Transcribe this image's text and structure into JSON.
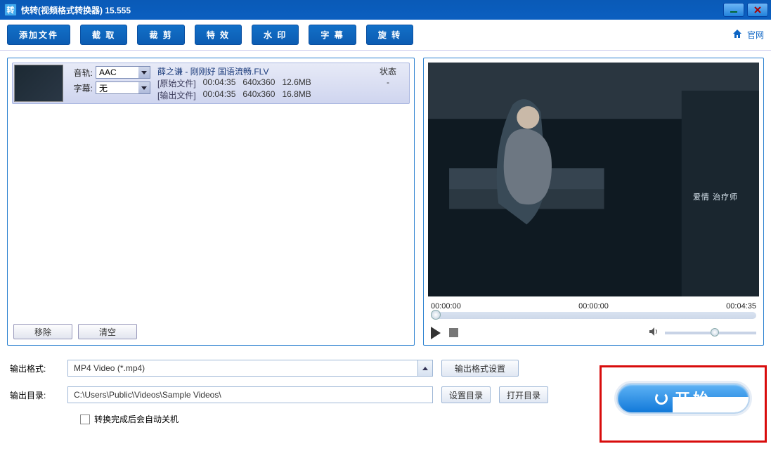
{
  "titlebar": {
    "title": "快转(视频格式转换器) 15.555",
    "icon_char": "转"
  },
  "toolbar": {
    "add_file": "添加文件",
    "capture": "截 取",
    "crop": "裁 剪",
    "effects": "特 效",
    "watermark": "水 印",
    "subtitle": "字 幕",
    "rotate": "旋 转",
    "site_link": "官网"
  },
  "file_item": {
    "audio_track_label": "音轨:",
    "audio_track_value": "AAC",
    "subtitle_label": "字幕:",
    "subtitle_value": "无",
    "filename": "薛之谦 - 刚刚好 国语流畅.FLV",
    "source_tag": "[原始文件]",
    "source_dur": "00:04:35",
    "source_res": "640x360",
    "source_size": "12.6MB",
    "output_tag": "[输出文件]",
    "output_dur": "00:04:35",
    "output_res": "640x360",
    "output_size": "16.8MB",
    "status_header": "状态",
    "status_value": "-",
    "overlay_text": "爱情 治疗师"
  },
  "left_panel": {
    "remove": "移除",
    "clear": "清空"
  },
  "player": {
    "t_start": "00:00:00",
    "t_mid": "00:00:00",
    "t_end": "00:04:35"
  },
  "bottom": {
    "format_label": "输出格式:",
    "format_value": "MP4 Video (*.mp4)",
    "format_settings": "输出格式设置",
    "dir_label": "输出目录:",
    "dir_value": "C:\\Users\\Public\\Videos\\Sample Videos\\",
    "set_dir": "设置目录",
    "open_dir": "打开目录",
    "shutdown": "转换完成后会自动关机",
    "start": "开始"
  }
}
